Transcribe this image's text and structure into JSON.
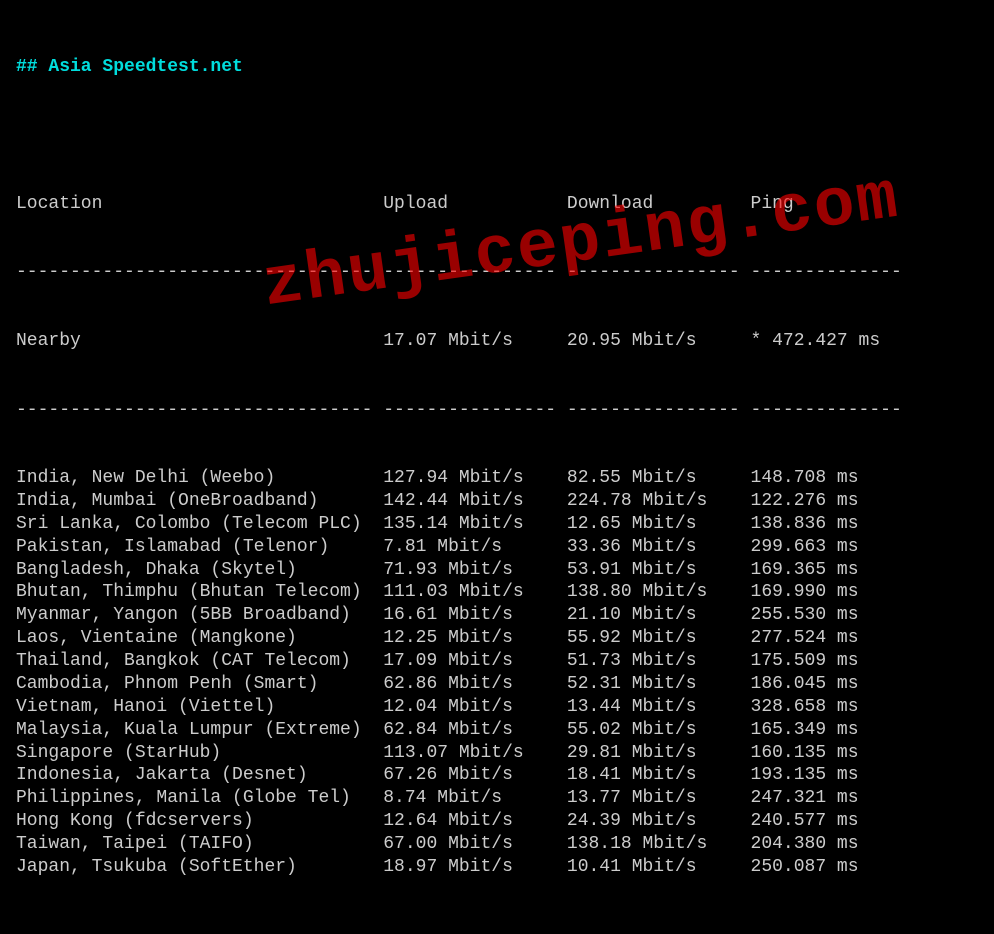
{
  "title": "## Asia Speedtest.net",
  "headers": {
    "location": "Location",
    "upload": "Upload",
    "download": "Download",
    "ping": "Ping"
  },
  "nearby": {
    "location": "Nearby",
    "upload": "17.07 Mbit/s",
    "download": "20.95 Mbit/s",
    "ping": "* 472.427 ms"
  },
  "rows": [
    {
      "location": "India, New Delhi (Weebo)",
      "upload": "127.94 Mbit/s",
      "download": "82.55 Mbit/s",
      "ping": "148.708 ms"
    },
    {
      "location": "India, Mumbai (OneBroadband)",
      "upload": "142.44 Mbit/s",
      "download": "224.78 Mbit/s",
      "ping": "122.276 ms"
    },
    {
      "location": "Sri Lanka, Colombo (Telecom PLC)",
      "upload": "135.14 Mbit/s",
      "download": "12.65 Mbit/s",
      "ping": "138.836 ms"
    },
    {
      "location": "Pakistan, Islamabad (Telenor)",
      "upload": "7.81 Mbit/s",
      "download": "33.36 Mbit/s",
      "ping": "299.663 ms"
    },
    {
      "location": "Bangladesh, Dhaka (Skytel)",
      "upload": "71.93 Mbit/s",
      "download": "53.91 Mbit/s",
      "ping": "169.365 ms"
    },
    {
      "location": "Bhutan, Thimphu (Bhutan Telecom)",
      "upload": "111.03 Mbit/s",
      "download": "138.80 Mbit/s",
      "ping": "169.990 ms"
    },
    {
      "location": "Myanmar, Yangon (5BB Broadband)",
      "upload": "16.61 Mbit/s",
      "download": "21.10 Mbit/s",
      "ping": "255.530 ms"
    },
    {
      "location": "Laos, Vientaine (Mangkone)",
      "upload": "12.25 Mbit/s",
      "download": "55.92 Mbit/s",
      "ping": "277.524 ms"
    },
    {
      "location": "Thailand, Bangkok (CAT Telecom)",
      "upload": "17.09 Mbit/s",
      "download": "51.73 Mbit/s",
      "ping": "175.509 ms"
    },
    {
      "location": "Cambodia, Phnom Penh (Smart)",
      "upload": "62.86 Mbit/s",
      "download": "52.31 Mbit/s",
      "ping": "186.045 ms"
    },
    {
      "location": "Vietnam, Hanoi (Viettel)",
      "upload": "12.04 Mbit/s",
      "download": "13.44 Mbit/s",
      "ping": "328.658 ms"
    },
    {
      "location": "Malaysia, Kuala Lumpur (Extreme)",
      "upload": "62.84 Mbit/s",
      "download": "55.02 Mbit/s",
      "ping": "165.349 ms"
    },
    {
      "location": "Singapore (StarHub)",
      "upload": "113.07 Mbit/s",
      "download": "29.81 Mbit/s",
      "ping": "160.135 ms"
    },
    {
      "location": "Indonesia, Jakarta (Desnet)",
      "upload": "67.26 Mbit/s",
      "download": "18.41 Mbit/s",
      "ping": "193.135 ms"
    },
    {
      "location": "Philippines, Manila (Globe Tel)",
      "upload": "8.74 Mbit/s",
      "download": "13.77 Mbit/s",
      "ping": "247.321 ms"
    },
    {
      "location": "Hong Kong (fdcservers)",
      "upload": "12.64 Mbit/s",
      "download": "24.39 Mbit/s",
      "ping": "240.577 ms"
    },
    {
      "location": "Taiwan, Taipei (TAIFO)",
      "upload": "67.00 Mbit/s",
      "download": "138.18 Mbit/s",
      "ping": "204.380 ms"
    },
    {
      "location": "Japan, Tsukuba (SoftEther)",
      "upload": "18.97 Mbit/s",
      "download": "10.41 Mbit/s",
      "ping": "250.087 ms"
    }
  ],
  "watermark": "zhujiceping.com",
  "columns": {
    "locationWidth": 34,
    "uploadWidth": 17,
    "downloadWidth": 17,
    "pingWidth": 14
  }
}
